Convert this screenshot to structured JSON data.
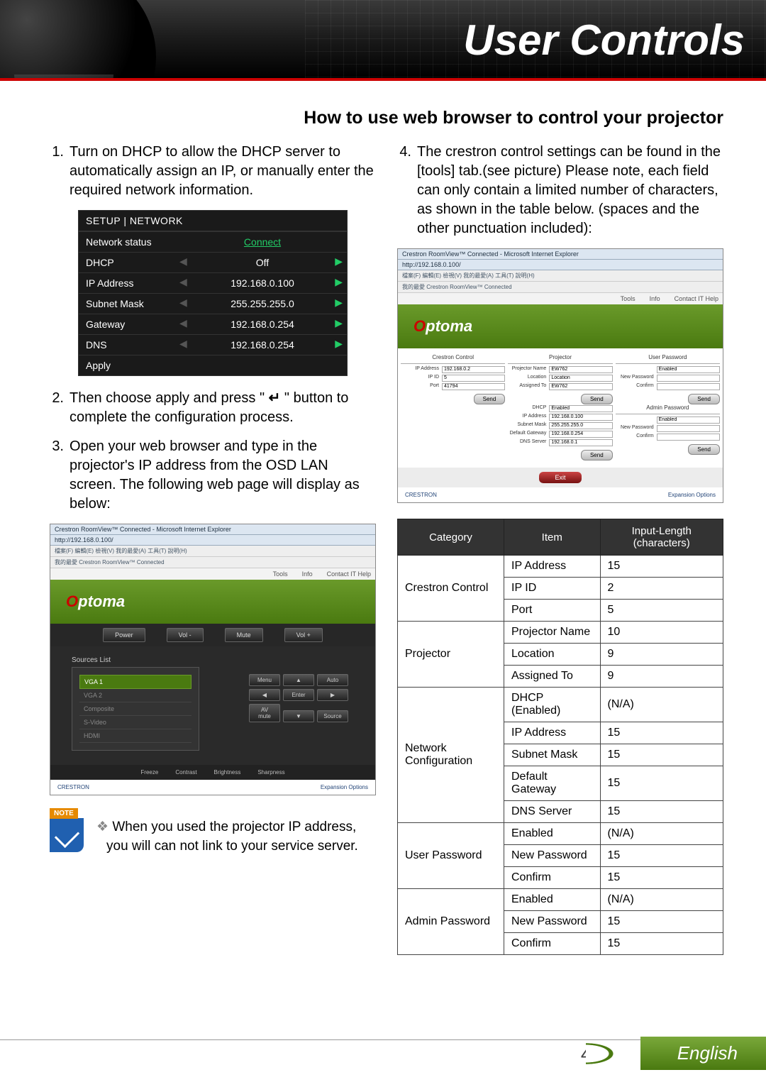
{
  "header": {
    "title": "User Controls"
  },
  "section_title": "How to use web browser to control your projector",
  "steps_left": {
    "s1": {
      "n": "1.",
      "text": "Turn on DHCP to allow the DHCP server to automatically assign an IP, or manually enter the required network information."
    },
    "s2": {
      "n": "2.",
      "pre": "Then choose apply and press \" ",
      "post": " \" button to complete the configuration process."
    },
    "s3": {
      "n": "3.",
      "text": "Open your web browser and type in the projector's IP address from the OSD LAN screen. The following web page will display as below:"
    }
  },
  "step_right": {
    "n": "4.",
    "text": "The crestron control settings can be found in the [tools] tab.(see picture) Please note, each field can only contain a limited number of characters, as shown in the table below. (spaces and the other punctuation included):"
  },
  "osd": {
    "header": "SETUP | NETWORK",
    "rows": [
      {
        "label": "Network status",
        "value": "Connect",
        "connect": true
      },
      {
        "label": "DHCP",
        "value": "Off",
        "arrows": true
      },
      {
        "label": "IP Address",
        "value": "192.168.0.100",
        "arrows": true
      },
      {
        "label": "Subnet Mask",
        "value": "255.255.255.0",
        "arrows": true
      },
      {
        "label": "Gateway",
        "value": "192.168.0.254",
        "arrows": true
      },
      {
        "label": "DNS",
        "value": "192.168.0.254",
        "arrows": true
      }
    ],
    "apply": "Apply"
  },
  "roomview": {
    "ie_title": "Crestron RoomView™ Connected - Microsoft Internet Explorer",
    "url": "http://192.168.0.100/",
    "menu": "檔案(F)  編輯(E)  檢視(V)  我的最愛(A)  工具(T)  說明(H)",
    "fav": "我的最愛     Crestron RoomView™ Connected",
    "bar": {
      "tools": "Tools",
      "info": "Info",
      "help": "Contact IT Help"
    },
    "brand": {
      "o": "O",
      "rest": "ptoma"
    },
    "top_btns": [
      "Power",
      "Vol -",
      "Mute",
      "Vol +"
    ],
    "sources_label": "Sources List",
    "sources": [
      "VGA 1",
      "VGA 2",
      "Composite",
      "S-Video",
      "HDMI"
    ],
    "ctrl": [
      "Menu",
      "▲",
      "Auto",
      "◀",
      "Enter",
      "▶",
      "AV mute",
      "▼",
      "Source"
    ],
    "sliders": [
      "Freeze",
      "Contrast",
      "Brightness",
      "Sharpness"
    ],
    "crestron": "CRESTRON",
    "exp": "Expansion Options"
  },
  "note": {
    "tag": "NOTE",
    "text": "When you used the projector IP address, you will can not link to your service server."
  },
  "tools": {
    "headers": [
      "Crestron Control",
      "Projector",
      "User Password"
    ],
    "crestron": [
      {
        "l": "IP Address",
        "v": "192.168.0.2"
      },
      {
        "l": "IP ID",
        "v": "5"
      },
      {
        "l": "Port",
        "v": "41794"
      }
    ],
    "projector": [
      {
        "l": "Projector Name",
        "v": "EW762"
      },
      {
        "l": "Location",
        "v": "Location"
      },
      {
        "l": "Assigned To",
        "v": "EW762"
      }
    ],
    "net": [
      {
        "l": "DHCP",
        "v": "Enabled"
      },
      {
        "l": "IP Address",
        "v": "192.168.0.100"
      },
      {
        "l": "Subnet Mask",
        "v": "255.255.255.0"
      },
      {
        "l": "Default Gateway",
        "v": "192.168.0.254"
      },
      {
        "l": "DNS Server",
        "v": "192.168.0.1"
      }
    ],
    "userpw": [
      {
        "l": "",
        "v": "Enabled"
      },
      {
        "l": "New Password",
        "v": ""
      },
      {
        "l": "Confirm",
        "v": ""
      }
    ],
    "adminpw_h": "Admin Password",
    "adminpw": [
      {
        "l": "",
        "v": "Enabled"
      },
      {
        "l": "New Password",
        "v": ""
      },
      {
        "l": "Confirm",
        "v": ""
      }
    ],
    "send": "Send",
    "exit": "Exit"
  },
  "spec": {
    "head": [
      "Category",
      "Item",
      "Input-Length (characters)"
    ],
    "rows": [
      {
        "cat": "Crestron Control",
        "span": 3,
        "item": "IP Address",
        "len": "15"
      },
      {
        "item": "IP ID",
        "len": "2"
      },
      {
        "item": "Port",
        "len": "5"
      },
      {
        "cat": "Projector",
        "span": 3,
        "item": "Projector Name",
        "len": "10"
      },
      {
        "item": "Location",
        "len": "9"
      },
      {
        "item": "Assigned To",
        "len": "9"
      },
      {
        "cat": "Network Configuration",
        "span": 5,
        "item": "DHCP (Enabled)",
        "len": "(N/A)"
      },
      {
        "item": "IP Address",
        "len": "15"
      },
      {
        "item": "Subnet Mask",
        "len": "15"
      },
      {
        "item": "Default Gateway",
        "len": "15"
      },
      {
        "item": "DNS Server",
        "len": "15"
      },
      {
        "cat": "User Password",
        "span": 3,
        "item": "Enabled",
        "len": "(N/A)"
      },
      {
        "item": "New Password",
        "len": "15"
      },
      {
        "item": "Confirm",
        "len": "15"
      },
      {
        "cat": "Admin Password",
        "span": 3,
        "item": "Enabled",
        "len": "(N/A)"
      },
      {
        "item": "New Password",
        "len": "15"
      },
      {
        "item": "Confirm",
        "len": "15"
      }
    ]
  },
  "footer": {
    "page": "43",
    "lang": "English"
  }
}
